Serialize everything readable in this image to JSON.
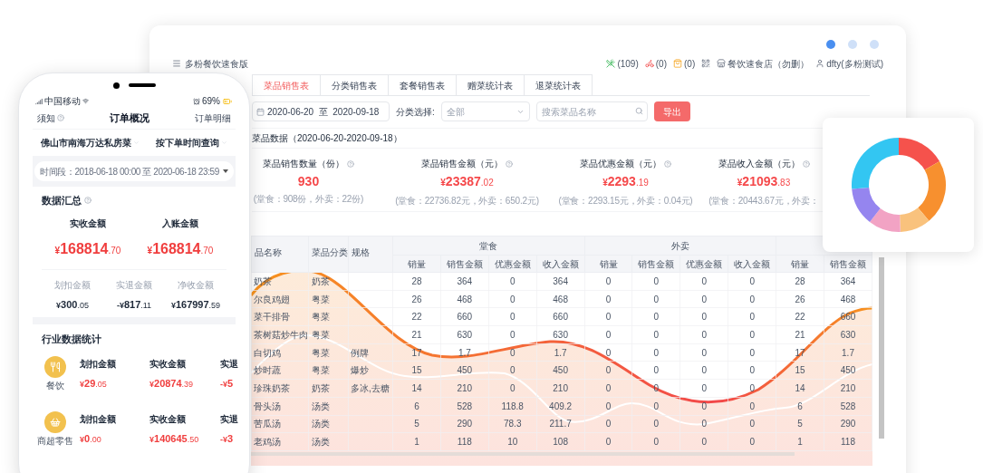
{
  "desktop": {
    "app_title": "多粉餐饮速食版",
    "header_items": [
      {
        "kind": "utensils",
        "text": "(109)"
      },
      {
        "kind": "scooter",
        "text": "(0)"
      },
      {
        "kind": "bag",
        "text": "(0)"
      },
      {
        "kind": "qr"
      },
      {
        "kind": "store",
        "text": "餐饮速食店（勿删）"
      },
      {
        "kind": "user",
        "text": "dfty(多粉测试)"
      }
    ],
    "tabs": [
      {
        "label": "菜品销售表",
        "selected": true
      },
      {
        "label": "分类销售表",
        "selected": false
      },
      {
        "label": "套餐销售表",
        "selected": false
      },
      {
        "label": "赠菜统计表",
        "selected": false
      },
      {
        "label": "退菜统计表",
        "selected": false
      }
    ],
    "filters": {
      "date_range": "2020-06-20  至  2020-09-18",
      "category_label": "分类选择:",
      "category_value": "全部",
      "search_placeholder": "搜索菜品名称",
      "export_button": "导出"
    },
    "section_title": "菜品数据（2020-06-20-2020-09-18）",
    "stats": [
      {
        "label": "菜品销售数量（份）",
        "integer": "930",
        "detail": "(堂食：908份，外卖：22份)"
      },
      {
        "label": "菜品销售金额（元）",
        "prefix": "¥",
        "integer": "23387",
        "decimal": ".02",
        "detail": "(堂食：22736.82元，外卖：650.2元)"
      },
      {
        "label": "菜品优惠金额（元）",
        "prefix": "¥",
        "integer": "2293",
        "decimal": ".19",
        "detail": "(堂食：2293.15元，外卖：0.04元)"
      },
      {
        "label": "菜品收入金额（元）",
        "prefix": "¥",
        "integer": "21093",
        "decimal": ".83",
        "detail": "(堂食：20443.67元，外卖："
      }
    ],
    "table": {
      "fixed_columns": [
        "品名称",
        "菜品分类",
        "规格"
      ],
      "groups": [
        {
          "label": "堂食",
          "columns": [
            "销量",
            "销售金额",
            "优惠金额",
            "收入金额"
          ]
        },
        {
          "label": "外卖",
          "columns": [
            "销量",
            "销售金额",
            "优惠金额",
            "收入金额"
          ]
        },
        {
          "columns": [
            "销量",
            "销售金额"
          ]
        }
      ],
      "rows": [
        {
          "name": "奶茶",
          "category": "奶茶",
          "values": [
            "28",
            "364",
            "0",
            "364",
            "0",
            "0",
            "0",
            "0",
            "28",
            "364"
          ]
        },
        {
          "name": "尔良鸡翅",
          "category": "粤菜",
          "values": [
            "26",
            "468",
            "0",
            "468",
            "0",
            "0",
            "0",
            "0",
            "26",
            "468"
          ]
        },
        {
          "name": "菜干排骨",
          "category": "粤菜",
          "values": [
            "22",
            "660",
            "0",
            "660",
            "0",
            "0",
            "0",
            "0",
            "22",
            "660"
          ]
        },
        {
          "name": "茶树菇炒牛肉",
          "category": "粤菜",
          "values": [
            "21",
            "630",
            "0",
            "630",
            "0",
            "0",
            "0",
            "0",
            "21",
            "630"
          ]
        },
        {
          "name": "白切鸡",
          "category": "粤菜",
          "spec": "例牌",
          "values": [
            "17",
            "1.7",
            "0",
            "1.7",
            "0",
            "0",
            "0",
            "0",
            "17",
            "1.7"
          ]
        },
        {
          "name": "炒时蔬",
          "category": "粤菜",
          "spec": "爆炒",
          "values": [
            "15",
            "450",
            "0",
            "450",
            "0",
            "0",
            "0",
            "0",
            "15",
            "450"
          ]
        },
        {
          "name": "珍珠奶茶",
          "category": "奶茶",
          "spec": "多冰,去糖",
          "values": [
            "14",
            "210",
            "0",
            "210",
            "0",
            "0",
            "0",
            "0",
            "14",
            "210"
          ]
        },
        {
          "name": "骨头汤",
          "category": "汤类",
          "values": [
            "6",
            "528",
            "118.8",
            "409.2",
            "0",
            "0",
            "0",
            "0",
            "6",
            "528"
          ]
        },
        {
          "name": "苦瓜汤",
          "category": "汤类",
          "values": [
            "5",
            "290",
            "78.3",
            "211.7",
            "0",
            "0",
            "0",
            "0",
            "5",
            "290"
          ]
        },
        {
          "name": "老鸡汤",
          "category": "汤类",
          "values": [
            "1",
            "118",
            "10",
            "108",
            "0",
            "0",
            "0",
            "0",
            "1",
            "118"
          ]
        }
      ]
    }
  },
  "phone": {
    "carrier": "中国移动",
    "battery": "69%",
    "nav": {
      "left": "须知",
      "title": "订单概况",
      "right": "订单明细"
    },
    "store": "佛山市南海万达私房菜",
    "query_mode": "按下单时间查询",
    "time_range": "时间段：2018-06-18 00:00 至 2020-06-18 23:59",
    "summary_title": "数据汇总",
    "main_amounts": [
      {
        "label": "实收金额",
        "prefix": "¥",
        "integer": "168814",
        "decimal": ".70"
      },
      {
        "label": "入账金额",
        "prefix": "¥",
        "integer": "168814",
        "decimal": ".70"
      }
    ],
    "sub_amounts": [
      {
        "label": "划扣金额",
        "prefix": "¥",
        "integer": "300",
        "decimal": ".05"
      },
      {
        "label": "实退金额",
        "prefix": "-¥",
        "integer": "817",
        "decimal": ".11"
      },
      {
        "label": "净收金额",
        "prefix": "¥",
        "integer": "167997",
        "decimal": ".59"
      }
    ],
    "industry_title": "行业数据统计",
    "industries": [
      {
        "name": "餐饮",
        "kind": "dining",
        "metrics": [
          {
            "label": "划扣金额",
            "prefix": "¥",
            "integer": "29",
            "decimal": ".05"
          },
          {
            "label": "实收金额",
            "prefix": "¥",
            "integer": "20874",
            "decimal": ".39"
          },
          {
            "label": "实退",
            "prefix": "-¥",
            "integer": "5"
          }
        ]
      },
      {
        "name": "商超零售",
        "kind": "retail",
        "metrics": [
          {
            "label": "划扣金额",
            "prefix": "¥",
            "integer": "0",
            "decimal": ".00"
          },
          {
            "label": "实收金额",
            "prefix": "¥",
            "integer": "140645",
            "decimal": ".50"
          },
          {
            "label": "实退",
            "prefix": "-¥",
            "integer": "3"
          }
        ]
      }
    ]
  }
}
